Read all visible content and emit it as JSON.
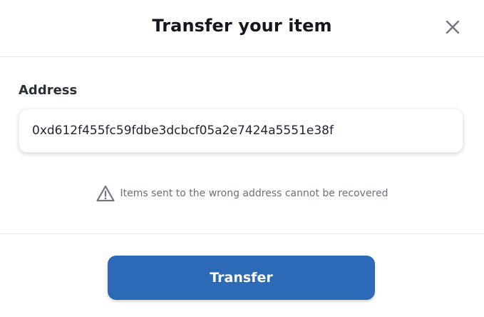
{
  "dialog": {
    "title": "Transfer your item",
    "close_icon": "close-icon"
  },
  "address_field": {
    "label": "Address",
    "value": "0xd612f455fc59fdbe3dcbcf05a2e7424a5551e38f",
    "placeholder": ""
  },
  "warning": {
    "icon": "warning-triangle-icon",
    "text": "Items sent to the wrong address cannot be recovered"
  },
  "footer": {
    "transfer_label": "Transfer"
  },
  "colors": {
    "primary_button": "#2c6ab8",
    "divider": "#e6e8ec",
    "muted_text": "#6b707a"
  }
}
